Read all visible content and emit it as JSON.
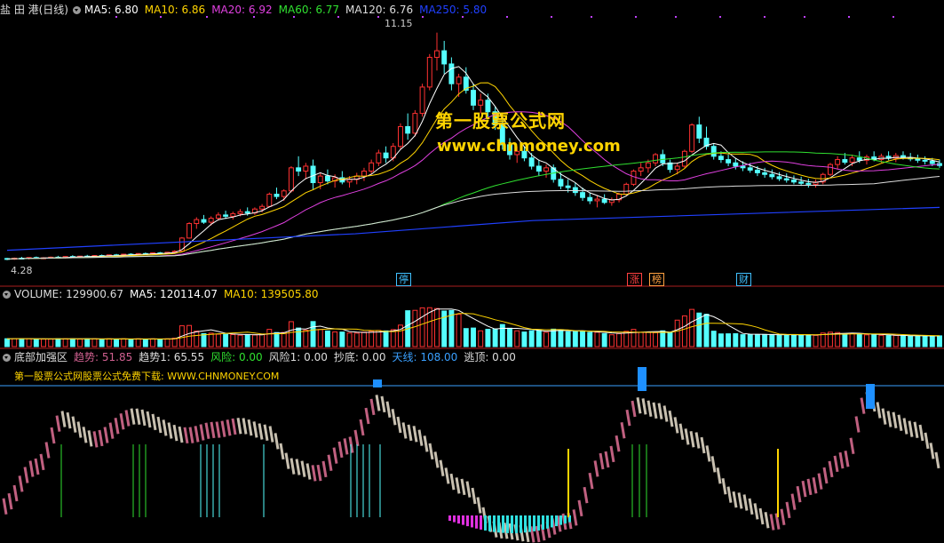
{
  "header_price": {
    "title": "盐 田 港(日线)",
    "ma": [
      {
        "label": "MA5: 6.80",
        "color": "#ffffff"
      },
      {
        "label": "MA10: 6.86",
        "color": "#ffd400"
      },
      {
        "label": "MA20: 6.92",
        "color": "#e040e0"
      },
      {
        "label": "MA60: 6.77",
        "color": "#30e030"
      },
      {
        "label": "MA120: 6.76",
        "color": "#dddddd"
      },
      {
        "label": "MA250: 5.80",
        "color": "#2040ff"
      }
    ],
    "high_label": "11.15",
    "low_label": "4.28"
  },
  "header_volume": {
    "items": [
      {
        "label": "VOLUME: 129900.67",
        "color": "#dddddd"
      },
      {
        "label": "MA5: 120114.07",
        "color": "#ffffff"
      },
      {
        "label": "MA10: 139505.80",
        "color": "#ffd400"
      }
    ]
  },
  "header_indicator": {
    "items": [
      {
        "label": "底部加强区",
        "color": "#dddddd"
      },
      {
        "label": "趋势: 51.85",
        "color": "#d06090"
      },
      {
        "label": "趋势1: 65.55",
        "color": "#dddddd"
      },
      {
        "label": "风险: 0.00",
        "color": "#30e030"
      },
      {
        "label": "风险1: 0.00",
        "color": "#dddddd"
      },
      {
        "label": "抄底: 0.00",
        "color": "#dddddd"
      },
      {
        "label": "天线: 108.00",
        "color": "#3aa0ff"
      },
      {
        "label": "逃顶: 0.00",
        "color": "#dddddd"
      }
    ],
    "promo": "第一股票公式网股票公式免费下载: WWW.CHNMONEY.COM"
  },
  "watermark": {
    "line1": "第一股票公式网",
    "line2": "www.chnmoney.com"
  },
  "markers": [
    {
      "text": "停",
      "color": "#40c0ff"
    },
    {
      "text": "涨",
      "color": "#ff4040"
    },
    {
      "text": "榜",
      "color": "#ffa040"
    },
    {
      "text": "财",
      "color": "#40c0ff"
    }
  ],
  "chart_data": {
    "type": "candlestick",
    "ylim": [
      4.0,
      11.6
    ],
    "candles": [
      [
        4.3,
        4.32,
        4.25,
        4.28
      ],
      [
        4.28,
        4.33,
        4.26,
        4.31
      ],
      [
        4.31,
        4.35,
        4.28,
        4.3
      ],
      [
        4.3,
        4.34,
        4.27,
        4.33
      ],
      [
        4.33,
        4.36,
        4.3,
        4.31
      ],
      [
        4.31,
        4.34,
        4.28,
        4.32
      ],
      [
        4.32,
        4.36,
        4.3,
        4.34
      ],
      [
        4.34,
        4.38,
        4.31,
        4.33
      ],
      [
        4.33,
        4.37,
        4.3,
        4.36
      ],
      [
        4.36,
        4.4,
        4.33,
        4.35
      ],
      [
        4.35,
        4.38,
        4.32,
        4.37
      ],
      [
        4.37,
        4.41,
        4.34,
        4.36
      ],
      [
        4.36,
        4.4,
        4.33,
        4.39
      ],
      [
        4.39,
        4.42,
        4.36,
        4.38
      ],
      [
        4.38,
        4.42,
        4.35,
        4.41
      ],
      [
        4.41,
        4.44,
        4.38,
        4.4
      ],
      [
        4.4,
        4.44,
        4.37,
        4.43
      ],
      [
        4.43,
        4.46,
        4.4,
        4.42
      ],
      [
        4.42,
        4.46,
        4.39,
        4.45
      ],
      [
        4.45,
        4.48,
        4.42,
        4.44
      ],
      [
        4.44,
        4.48,
        4.41,
        4.47
      ],
      [
        4.47,
        4.5,
        4.44,
        4.46
      ],
      [
        4.46,
        4.5,
        4.43,
        4.49
      ],
      [
        4.49,
        4.55,
        4.46,
        4.52
      ],
      [
        4.52,
        4.95,
        4.5,
        4.92
      ],
      [
        4.92,
        5.4,
        4.9,
        5.36
      ],
      [
        5.36,
        5.55,
        5.2,
        5.48
      ],
      [
        5.48,
        5.62,
        5.35,
        5.4
      ],
      [
        5.4,
        5.58,
        5.3,
        5.52
      ],
      [
        5.52,
        5.7,
        5.45,
        5.62
      ],
      [
        5.62,
        5.75,
        5.5,
        5.58
      ],
      [
        5.58,
        5.72,
        5.48,
        5.66
      ],
      [
        5.66,
        5.8,
        5.58,
        5.72
      ],
      [
        5.72,
        5.85,
        5.6,
        5.68
      ],
      [
        5.68,
        5.85,
        5.62,
        5.8
      ],
      [
        5.8,
        5.95,
        5.7,
        5.88
      ],
      [
        5.88,
        6.3,
        5.85,
        6.25
      ],
      [
        6.25,
        6.45,
        6.1,
        6.18
      ],
      [
        6.18,
        6.4,
        6.05,
        6.35
      ],
      [
        6.35,
        7.1,
        6.3,
        7.05
      ],
      [
        7.05,
        7.4,
        6.8,
        6.95
      ],
      [
        6.95,
        7.2,
        6.7,
        7.1
      ],
      [
        7.1,
        7.3,
        6.4,
        6.6
      ],
      [
        6.6,
        6.9,
        6.4,
        6.8
      ],
      [
        6.8,
        7.0,
        6.55,
        6.65
      ],
      [
        6.65,
        6.85,
        6.45,
        6.75
      ],
      [
        6.75,
        6.95,
        6.55,
        6.62
      ],
      [
        6.62,
        6.8,
        6.45,
        6.7
      ],
      [
        6.7,
        6.9,
        6.55,
        6.8
      ],
      [
        6.8,
        7.05,
        6.65,
        6.95
      ],
      [
        6.95,
        7.3,
        6.85,
        7.2
      ],
      [
        7.2,
        7.6,
        7.1,
        7.5
      ],
      [
        7.5,
        7.7,
        7.2,
        7.35
      ],
      [
        7.35,
        7.8,
        7.25,
        7.7
      ],
      [
        7.7,
        8.4,
        7.6,
        8.3
      ],
      [
        8.3,
        8.7,
        7.9,
        8.1
      ],
      [
        8.1,
        8.8,
        8.0,
        8.7
      ],
      [
        8.7,
        9.6,
        8.6,
        9.5
      ],
      [
        9.5,
        10.5,
        9.4,
        10.4
      ],
      [
        10.4,
        11.15,
        10.0,
        10.6
      ],
      [
        10.6,
        10.9,
        9.9,
        10.2
      ],
      [
        10.2,
        10.4,
        9.4,
        9.6
      ],
      [
        9.6,
        9.9,
        9.2,
        9.8
      ],
      [
        9.8,
        10.1,
        9.3,
        9.4
      ],
      [
        9.4,
        9.6,
        8.8,
        8.95
      ],
      [
        8.95,
        9.3,
        8.7,
        9.1
      ],
      [
        9.1,
        9.3,
        8.6,
        8.75
      ],
      [
        8.75,
        8.9,
        8.2,
        8.35
      ],
      [
        8.35,
        8.5,
        7.6,
        7.75
      ],
      [
        7.75,
        7.95,
        7.3,
        7.45
      ],
      [
        7.45,
        7.7,
        7.2,
        7.55
      ],
      [
        7.55,
        7.7,
        7.25,
        7.35
      ],
      [
        7.35,
        7.5,
        7.0,
        7.1
      ],
      [
        7.1,
        7.3,
        6.8,
        6.95
      ],
      [
        6.95,
        7.15,
        6.75,
        7.05
      ],
      [
        7.05,
        7.15,
        6.6,
        6.7
      ],
      [
        6.7,
        6.9,
        6.4,
        6.5
      ],
      [
        6.5,
        6.7,
        6.3,
        6.45
      ],
      [
        6.45,
        6.6,
        6.2,
        6.3
      ],
      [
        6.3,
        6.45,
        6.05,
        6.15
      ],
      [
        6.15,
        6.3,
        5.95,
        6.05
      ],
      [
        6.05,
        6.2,
        5.85,
        6.1
      ],
      [
        6.1,
        6.25,
        5.95,
        6.0
      ],
      [
        6.0,
        6.15,
        5.9,
        6.08
      ],
      [
        6.08,
        6.3,
        6.0,
        6.25
      ],
      [
        6.25,
        6.6,
        6.2,
        6.55
      ],
      [
        6.55,
        7.0,
        6.5,
        6.95
      ],
      [
        6.95,
        7.2,
        6.8,
        7.05
      ],
      [
        7.05,
        7.3,
        6.9,
        7.2
      ],
      [
        7.2,
        7.5,
        7.1,
        7.45
      ],
      [
        7.45,
        7.6,
        7.1,
        7.2
      ],
      [
        7.2,
        7.3,
        6.9,
        7.0
      ],
      [
        7.0,
        7.2,
        6.85,
        7.1
      ],
      [
        7.1,
        7.6,
        7.05,
        7.55
      ],
      [
        7.55,
        8.4,
        7.5,
        8.35
      ],
      [
        8.35,
        8.6,
        7.8,
        7.95
      ],
      [
        7.95,
        8.3,
        7.6,
        7.7
      ],
      [
        7.7,
        7.8,
        7.3,
        7.4
      ],
      [
        7.4,
        7.55,
        7.2,
        7.3
      ],
      [
        7.3,
        7.45,
        7.1,
        7.2
      ],
      [
        7.2,
        7.35,
        7.0,
        7.1
      ],
      [
        7.1,
        7.25,
        6.95,
        7.05
      ],
      [
        7.05,
        7.2,
        6.9,
        6.98
      ],
      [
        6.98,
        7.1,
        6.8,
        6.9
      ],
      [
        6.9,
        7.05,
        6.75,
        6.85
      ],
      [
        6.85,
        7.0,
        6.7,
        6.78
      ],
      [
        6.78,
        6.92,
        6.65,
        6.72
      ],
      [
        6.72,
        6.88,
        6.6,
        6.68
      ],
      [
        6.68,
        6.82,
        6.55,
        6.62
      ],
      [
        6.62,
        6.78,
        6.5,
        6.58
      ],
      [
        6.58,
        6.72,
        6.45,
        6.55
      ],
      [
        6.55,
        6.7,
        6.45,
        6.62
      ],
      [
        6.62,
        6.9,
        6.55,
        6.85
      ],
      [
        6.85,
        7.2,
        6.8,
        7.15
      ],
      [
        7.15,
        7.4,
        7.0,
        7.3
      ],
      [
        7.3,
        7.5,
        7.15,
        7.22
      ],
      [
        7.22,
        7.45,
        7.1,
        7.35
      ],
      [
        7.35,
        7.55,
        7.2,
        7.28
      ],
      [
        7.28,
        7.45,
        7.15,
        7.38
      ],
      [
        7.38,
        7.55,
        7.25,
        7.3
      ],
      [
        7.3,
        7.48,
        7.2,
        7.4
      ],
      [
        7.4,
        7.55,
        7.28,
        7.34
      ],
      [
        7.34,
        7.5,
        7.22,
        7.42
      ],
      [
        7.42,
        7.55,
        7.3,
        7.36
      ],
      [
        7.36,
        7.5,
        7.25,
        7.32
      ],
      [
        7.32,
        7.45,
        7.2,
        7.28
      ],
      [
        7.28,
        7.4,
        7.15,
        7.25
      ],
      [
        7.25,
        7.35,
        7.1,
        7.18
      ],
      [
        7.18,
        7.3,
        7.05,
        7.12
      ]
    ]
  }
}
